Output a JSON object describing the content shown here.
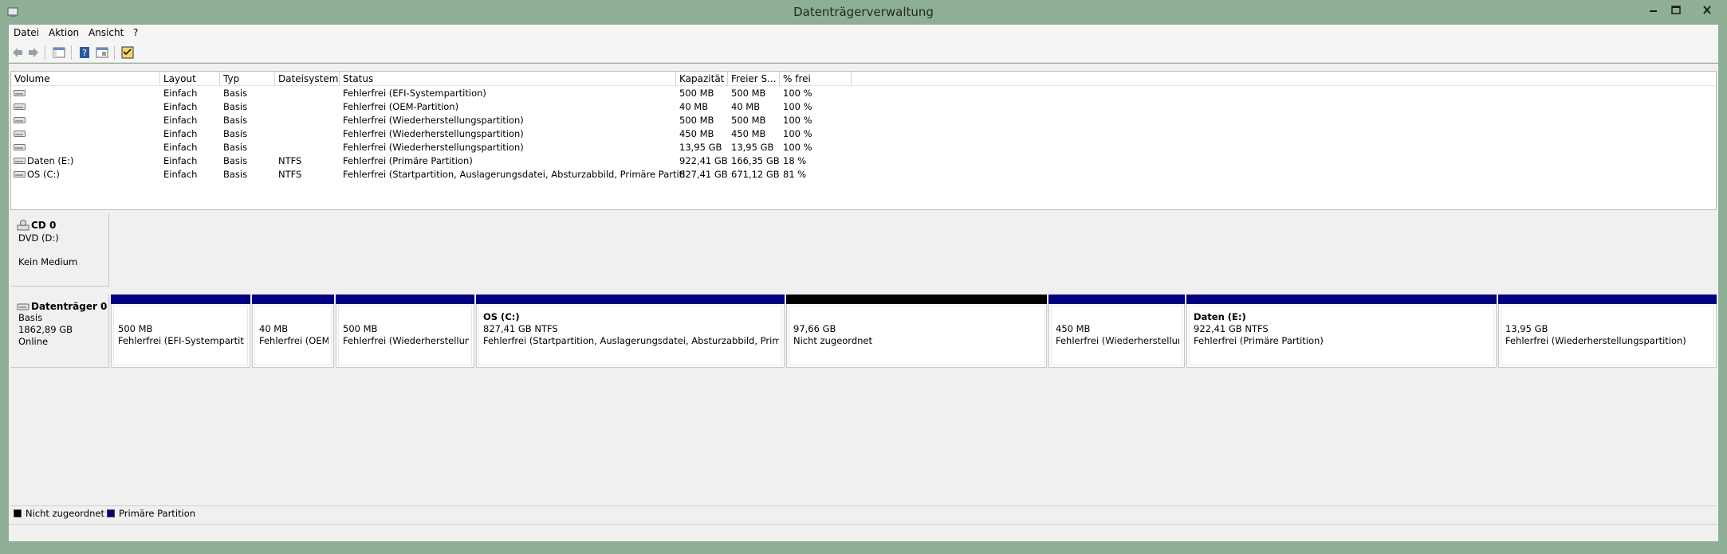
{
  "window": {
    "title": "Datenträgerverwaltung"
  },
  "menu": [
    {
      "label": "Datei"
    },
    {
      "label": "Aktion"
    },
    {
      "label": "Ansicht"
    },
    {
      "label": "?"
    }
  ],
  "volume_list": {
    "headers": [
      "Volume",
      "Layout",
      "Typ",
      "Dateisystem",
      "Status",
      "Kapazität",
      "Freier S...",
      "% frei"
    ],
    "rows": [
      {
        "volume": "",
        "layout": "Einfach",
        "typ": "Basis",
        "fs": "",
        "status": "Fehlerfrei (EFI-Systempartition)",
        "kapazitaet": "500 MB",
        "frei": "500 MB",
        "pct": "100 %"
      },
      {
        "volume": "",
        "layout": "Einfach",
        "typ": "Basis",
        "fs": "",
        "status": "Fehlerfrei (OEM-Partition)",
        "kapazitaet": "40 MB",
        "frei": "40 MB",
        "pct": "100 %"
      },
      {
        "volume": "",
        "layout": "Einfach",
        "typ": "Basis",
        "fs": "",
        "status": "Fehlerfrei (Wiederherstellungspartition)",
        "kapazitaet": "500 MB",
        "frei": "500 MB",
        "pct": "100 %"
      },
      {
        "volume": "",
        "layout": "Einfach",
        "typ": "Basis",
        "fs": "",
        "status": "Fehlerfrei (Wiederherstellungspartition)",
        "kapazitaet": "450 MB",
        "frei": "450 MB",
        "pct": "100 %"
      },
      {
        "volume": "",
        "layout": "Einfach",
        "typ": "Basis",
        "fs": "",
        "status": "Fehlerfrei (Wiederherstellungspartition)",
        "kapazitaet": "13,95 GB",
        "frei": "13,95 GB",
        "pct": "100 %"
      },
      {
        "volume": "Daten (E:)",
        "layout": "Einfach",
        "typ": "Basis",
        "fs": "NTFS",
        "status": "Fehlerfrei (Primäre Partition)",
        "kapazitaet": "922,41 GB",
        "frei": "166,35 GB",
        "pct": "18 %"
      },
      {
        "volume": "OS (C:)",
        "layout": "Einfach",
        "typ": "Basis",
        "fs": "NTFS",
        "status": "Fehlerfrei (Startpartition, Auslagerungsdatei, Absturzabbild, Primäre Partition)",
        "kapazitaet": "827,41 GB",
        "frei": "671,12 GB",
        "pct": "81 %"
      }
    ]
  },
  "cd0": {
    "name": "CD 0",
    "drive": "DVD (D:)",
    "state": "Kein Medium"
  },
  "disk0": {
    "name": "Datenträger 0",
    "type": "Basis",
    "size": "1862,89 GB",
    "state": "Online",
    "partitions": [
      {
        "name": "",
        "size": "500 MB",
        "status": "Fehlerfrei (EFI-Systempartition",
        "kind": "primary"
      },
      {
        "name": "",
        "size": "40 MB",
        "status": "Fehlerfrei (OEM-I",
        "kind": "primary"
      },
      {
        "name": "",
        "size": "500 MB",
        "status": "Fehlerfrei (Wiederherstellungsp",
        "kind": "primary"
      },
      {
        "name": "OS  (C:)",
        "size": "827,41 GB NTFS",
        "status": "Fehlerfrei (Startpartition, Auslagerungsdatei, Absturzabbild, Primäre Pa",
        "kind": "primary"
      },
      {
        "name": "",
        "size": "97,66 GB",
        "status": "Nicht zugeordnet",
        "kind": "unallocated"
      },
      {
        "name": "",
        "size": "450 MB",
        "status": "Fehlerfrei (Wiederherstellungs",
        "kind": "primary"
      },
      {
        "name": "Daten  (E:)",
        "size": "922,41 GB NTFS",
        "status": "Fehlerfrei (Primäre Partition)",
        "kind": "primary"
      },
      {
        "name": "",
        "size": "13,95 GB",
        "status": "Fehlerfrei (Wiederherstellungspartition)",
        "kind": "primary"
      }
    ]
  },
  "legend": {
    "unallocated": "Nicht zugeordnet",
    "primary": "Primäre Partition"
  },
  "colors": {
    "primary": "#000080",
    "unallocated": "#000000",
    "titlebar": "#8fae96"
  }
}
